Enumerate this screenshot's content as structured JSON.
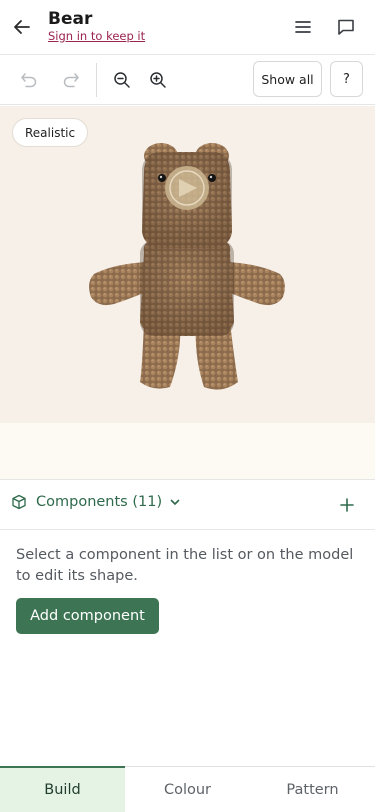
{
  "header": {
    "title": "Bear",
    "signin_link": "Sign in to keep it",
    "icons": {
      "back": "arrow-left-icon",
      "menu": "hamburger-menu-icon",
      "comments": "chat-bubble-icon"
    }
  },
  "toolbar": {
    "icons": {
      "undo": "undo-icon",
      "redo": "redo-icon",
      "zoom_out": "zoom-out-icon",
      "zoom_in": "zoom-in-icon"
    },
    "undo_enabled": false,
    "redo_enabled": false,
    "show_all_label": "Show all",
    "help_label": "?"
  },
  "viewport": {
    "render_mode": "Realistic",
    "background_color": "#f6f0e8",
    "model_color": "#8a6a4c"
  },
  "components": {
    "label": "Components (11)",
    "icons": {
      "cube": "cube-icon",
      "expand": "chevron-down-icon",
      "add": "plus-icon"
    },
    "helper_text": "Select a component in the list or on the model to edit its shape.",
    "add_button_label": "Add component"
  },
  "tabs": [
    {
      "label": "Build",
      "active": true
    },
    {
      "label": "Colour",
      "active": false
    },
    {
      "label": "Pattern",
      "active": false
    }
  ],
  "colors": {
    "accent_green": "#3d7554",
    "link_magenta": "#9b2350"
  }
}
